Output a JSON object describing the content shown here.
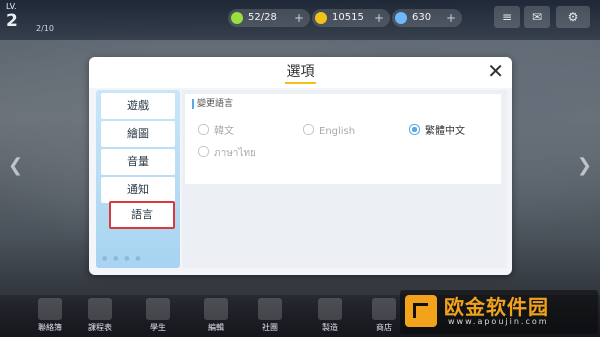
{
  "hud": {
    "level_label": "LV.",
    "level": "2",
    "exp": "2/10",
    "stamina": "52/28",
    "coins": "10515",
    "gems": "630",
    "stamina_color": "#9adf3c",
    "coin_color": "#f2c21b",
    "gem_color": "#6fb7ff",
    "plus": "+"
  },
  "dialog": {
    "title": "選項",
    "close": "✕",
    "tabs": [
      {
        "label": "遊戲"
      },
      {
        "label": "繪圖"
      },
      {
        "label": "音量"
      },
      {
        "label": "通知"
      },
      {
        "label": "語言",
        "active": true
      }
    ],
    "language_panel": {
      "title": "變更語言",
      "options": [
        {
          "label": "韓文",
          "selected": false
        },
        {
          "label": "English",
          "selected": false
        },
        {
          "label": "繁體中文",
          "selected": true
        },
        {
          "label": "ภาษาไทย",
          "selected": false
        }
      ]
    }
  },
  "bottom_nav": [
    {
      "label": "聯絡簿"
    },
    {
      "label": "課程表"
    },
    {
      "label": "學生"
    },
    {
      "label": "編輯"
    },
    {
      "label": "社團"
    },
    {
      "label": "製造"
    },
    {
      "label": "商店"
    }
  ],
  "watermark": {
    "name": "欧金软件园",
    "url": "www.apoujin.com"
  },
  "colors": {
    "accent": "#f2c21b",
    "active_tab_border": "#d83a3a",
    "sidebar": "#b8dcf4"
  }
}
